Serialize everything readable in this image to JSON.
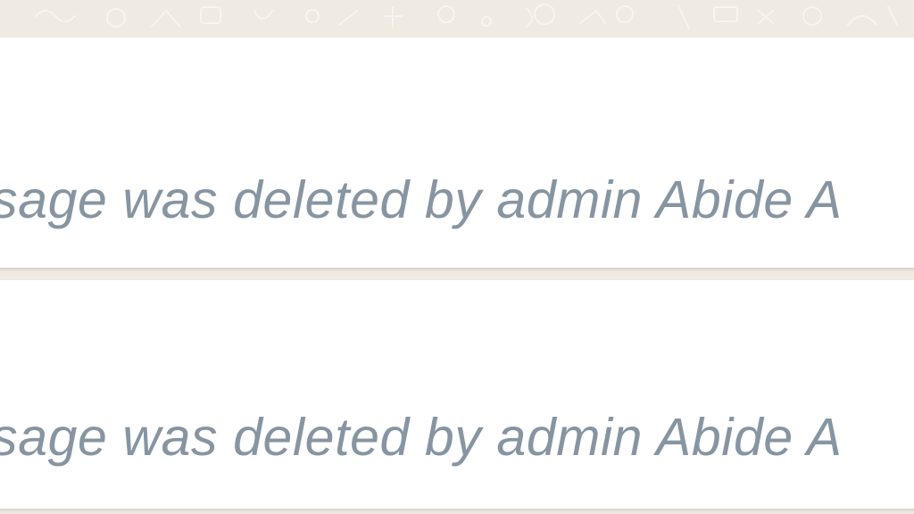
{
  "chat": {
    "background_color": "#efeae2",
    "bubble_color": "#ffffff",
    "deleted_text_color": "#8695a1",
    "messages": [
      {
        "text": "ssage was deleted by admin Abide A"
      },
      {
        "text": "ssage was deleted by admin Abide A"
      }
    ]
  }
}
